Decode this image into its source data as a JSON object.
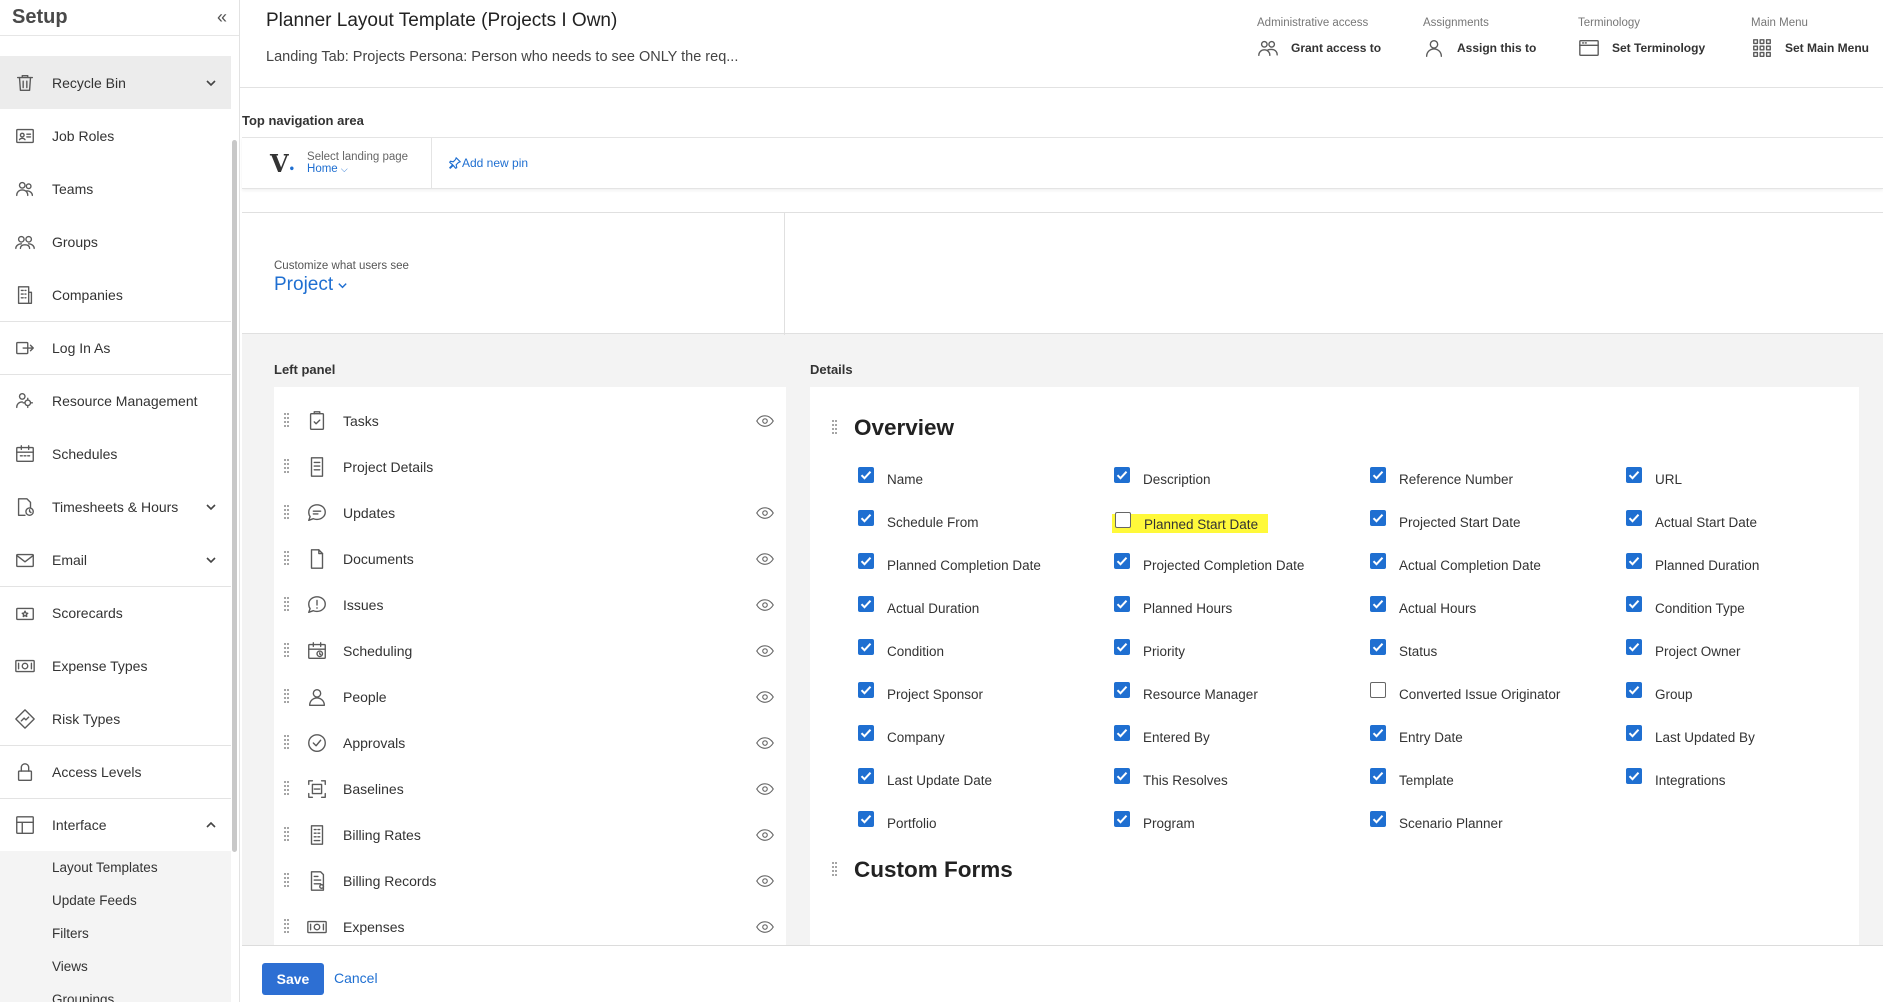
{
  "sidebar": {
    "title": "Setup",
    "collapse_glyph": "«",
    "items": [
      {
        "label": "Recycle Bin",
        "icon": "trash-icon",
        "chevron": "down",
        "active": true
      },
      {
        "label": "Job Roles",
        "icon": "id-card-icon"
      },
      {
        "label": "Teams",
        "icon": "team-icon"
      },
      {
        "label": "Groups",
        "icon": "group-icon"
      },
      {
        "label": "Companies",
        "icon": "building-icon"
      },
      {
        "label": "Log In As",
        "icon": "login-icon"
      },
      {
        "label": "Resource Management",
        "icon": "resource-icon"
      },
      {
        "label": "Schedules",
        "icon": "calendar-icon"
      },
      {
        "label": "Timesheets & Hours",
        "icon": "timesheet-icon",
        "chevron": "down"
      },
      {
        "label": "Email",
        "icon": "mail-icon",
        "chevron": "down"
      },
      {
        "label": "Scorecards",
        "icon": "scorecard-icon"
      },
      {
        "label": "Expense Types",
        "icon": "money-icon"
      },
      {
        "label": "Risk Types",
        "icon": "risk-icon"
      },
      {
        "label": "Access Levels",
        "icon": "lock-icon"
      },
      {
        "label": "Interface",
        "icon": "layout-icon",
        "chevron": "up"
      }
    ],
    "subitems": [
      "Layout Templates",
      "Update Feeds",
      "Filters",
      "Views",
      "Groupings"
    ]
  },
  "header": {
    "title": "Planner Layout Template (Projects I Own)",
    "subtitle": "Landing Tab: Projects Persona: Person who needs to see ONLY the req...",
    "actions": [
      {
        "caption": "Administrative access",
        "label": "Grant access to",
        "icon": "users-icon"
      },
      {
        "caption": "Assignments",
        "label": "Assign this to",
        "icon": "user-icon"
      },
      {
        "caption": "Terminology",
        "label": "Set Terminology",
        "icon": "window-icon"
      },
      {
        "caption": "Main Menu",
        "label": "Set Main Menu",
        "icon": "grid-icon"
      }
    ]
  },
  "top_nav": {
    "label": "Top navigation area",
    "logo": "V",
    "landing_caption": "Select landing page",
    "landing_value": "Home",
    "add_pin": "Add new pin"
  },
  "customize": {
    "caption": "Customize what users see",
    "value": "Project"
  },
  "left_panel": {
    "label": "Left panel",
    "items": [
      {
        "label": "Tasks",
        "icon": "clipboard-check-icon",
        "eye": true
      },
      {
        "label": "Project Details",
        "icon": "document-lines-icon",
        "eye": false
      },
      {
        "label": "Updates",
        "icon": "chat-bubble-icon",
        "eye": true
      },
      {
        "label": "Documents",
        "icon": "document-icon",
        "eye": true
      },
      {
        "label": "Issues",
        "icon": "alert-bubble-icon",
        "eye": true
      },
      {
        "label": "Scheduling",
        "icon": "calendar-clock-icon",
        "eye": true
      },
      {
        "label": "People",
        "icon": "person-icon",
        "eye": true
      },
      {
        "label": "Approvals",
        "icon": "check-circle-icon",
        "eye": true
      },
      {
        "label": "Baselines",
        "icon": "baseline-icon",
        "eye": true
      },
      {
        "label": "Billing Rates",
        "icon": "billing-icon",
        "eye": true
      },
      {
        "label": "Billing Records",
        "icon": "billing-records-icon",
        "eye": true
      },
      {
        "label": "Expenses",
        "icon": "money-icon",
        "eye": true
      }
    ]
  },
  "details": {
    "label": "Details",
    "overview_title": "Overview",
    "custom_forms_title": "Custom Forms",
    "fields": [
      {
        "label": "Name",
        "checked": true
      },
      {
        "label": "Description",
        "checked": true
      },
      {
        "label": "Reference Number",
        "checked": true
      },
      {
        "label": "URL",
        "checked": true
      },
      {
        "label": "Schedule From",
        "checked": true
      },
      {
        "label": "Planned Start Date",
        "checked": false,
        "highlight": true
      },
      {
        "label": "Projected Start Date",
        "checked": true
      },
      {
        "label": "Actual Start Date",
        "checked": true
      },
      {
        "label": "Planned Completion Date",
        "checked": true
      },
      {
        "label": "Projected Completion Date",
        "checked": true
      },
      {
        "label": "Actual Completion Date",
        "checked": true
      },
      {
        "label": "Planned Duration",
        "checked": true
      },
      {
        "label": "Actual Duration",
        "checked": true
      },
      {
        "label": "Planned Hours",
        "checked": true
      },
      {
        "label": "Actual Hours",
        "checked": true
      },
      {
        "label": "Condition Type",
        "checked": true
      },
      {
        "label": "Condition",
        "checked": true
      },
      {
        "label": "Priority",
        "checked": true
      },
      {
        "label": "Status",
        "checked": true
      },
      {
        "label": "Project Owner",
        "checked": true
      },
      {
        "label": "Project Sponsor",
        "checked": true
      },
      {
        "label": "Resource Manager",
        "checked": true
      },
      {
        "label": "Converted Issue Originator",
        "checked": false
      },
      {
        "label": "Group",
        "checked": true
      },
      {
        "label": "Company",
        "checked": true
      },
      {
        "label": "Entered By",
        "checked": true
      },
      {
        "label": "Entry Date",
        "checked": true
      },
      {
        "label": "Last Updated By",
        "checked": true
      },
      {
        "label": "Last Update Date",
        "checked": true
      },
      {
        "label": "This Resolves",
        "checked": true
      },
      {
        "label": "Template",
        "checked": true
      },
      {
        "label": "Integrations",
        "checked": true
      },
      {
        "label": "Portfolio",
        "checked": true
      },
      {
        "label": "Program",
        "checked": true
      },
      {
        "label": "Scenario Planner",
        "checked": true
      }
    ]
  },
  "footer": {
    "save": "Save",
    "cancel": "Cancel"
  },
  "colors": {
    "accent": "#1f6fd1",
    "highlight": "#fff93a",
    "save_button": "#2d6fd3"
  }
}
